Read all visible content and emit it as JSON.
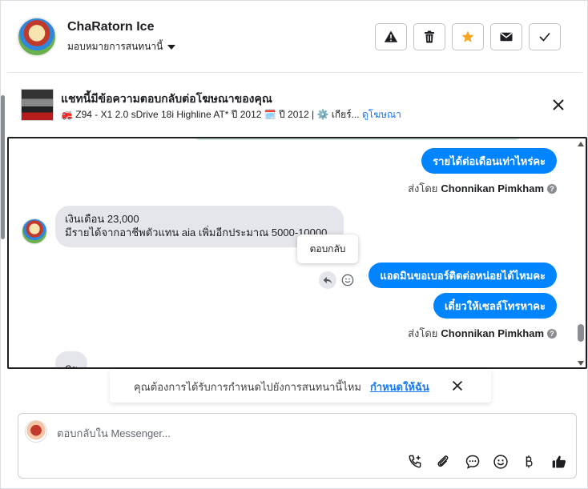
{
  "header": {
    "user_name": "ChaRatorn Ice",
    "assign_label": "มอบหมายการสนทนานี้",
    "actions": [
      {
        "name": "report-button",
        "icon": "warning-icon"
      },
      {
        "name": "delete-button",
        "icon": "trash-icon"
      },
      {
        "name": "star-button",
        "icon": "star-icon",
        "color": "#f5a623"
      },
      {
        "name": "mail-button",
        "icon": "envelope-icon"
      },
      {
        "name": "done-button",
        "icon": "check-icon"
      }
    ]
  },
  "ad": {
    "title": "แชทนี้มีข้อความตอบกลับต่อโฆษณาของคุณ",
    "subtitle": "🚒 Z94 - X1 2.0 sDrive 18i Highline AT* ปี 2012 🗓️ ปี 2012 | ⚙️ เกียร์...",
    "link": "ดูโฆษณา"
  },
  "messages": {
    "out1": "รายได้ต่อเดือนเท่าไหร่คะ",
    "sent_by_label": "ส่งโดย",
    "sender": "Chonnikan Pimkham",
    "in1_line1": "เงินเดือน 23,000",
    "in1_line2": "มีรายได้จากอาชีพตัวแทน aia เพิ่มอีกประมาณ 5000-10000",
    "tooltip": "ตอบกลับ",
    "out2": "แอดมินขอเบอร์ติดต่อหน่อยได้ไหมคะ",
    "out3": "เดี๋ยวให้เซลล์โทรหาคะ",
    "in2_partial": "คะ"
  },
  "assign_banner": {
    "text": "คุณต้องการได้รับการกำหนดไปยังการสนทนานี้ไหม",
    "link": "กำหนดให้ฉัน"
  },
  "composer": {
    "placeholder": "ตอบกลับใน Messenger...",
    "tools": [
      "call-add-icon",
      "paperclip-icon",
      "chat-bubble-icon",
      "emoji-icon",
      "baht-icon",
      "thumbs-up-icon"
    ]
  },
  "colors": {
    "accent": "#0084ff",
    "link": "#1877f2",
    "star": "#f5a623"
  }
}
